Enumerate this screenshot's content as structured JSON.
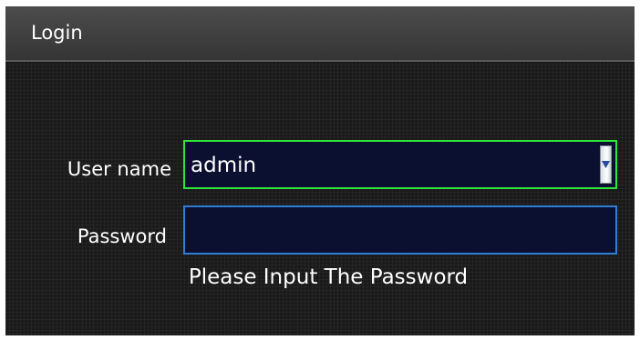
{
  "window": {
    "title": "Login"
  },
  "form": {
    "username_label": "User name",
    "username_value": "admin",
    "password_label": "Password",
    "password_value": "",
    "hint": "Please Input The Password"
  },
  "icons": {
    "dropdown": "chevron-down-icon"
  },
  "colors": {
    "focus_border": "#2ee63c",
    "input_border": "#2f7fd8",
    "input_bg": "#0c1030"
  }
}
